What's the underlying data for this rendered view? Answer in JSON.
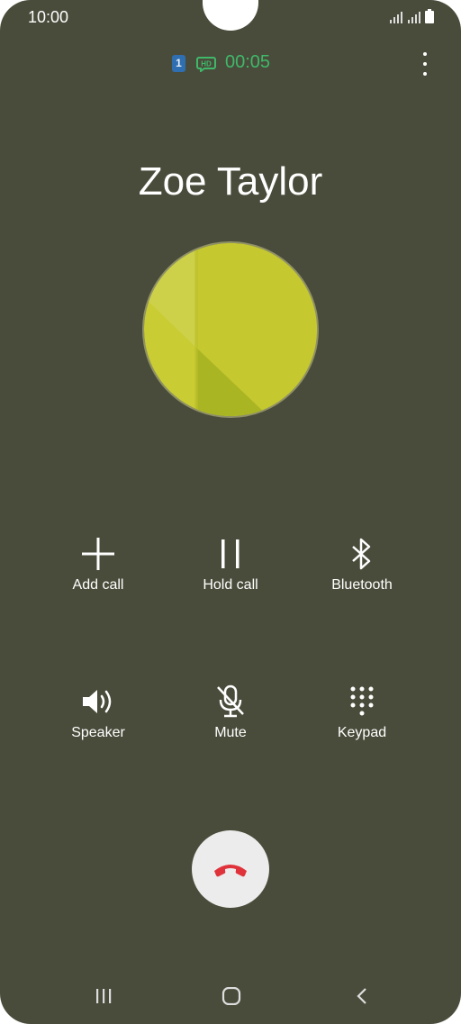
{
  "status_bar": {
    "time": "10:00"
  },
  "call": {
    "sim_slot": "1",
    "quality_icon": "hd-voice-icon",
    "duration": "00:05",
    "caller_name": "Zoe Taylor"
  },
  "controls": {
    "add_call": "Add call",
    "hold_call": "Hold call",
    "bluetooth": "Bluetooth",
    "speaker": "Speaker",
    "mute": "Mute",
    "keypad": "Keypad"
  },
  "colors": {
    "background": "#4a4c3b",
    "timer": "#3fb86a",
    "end_call": "#e0323a",
    "avatar": "#c9cc33"
  }
}
